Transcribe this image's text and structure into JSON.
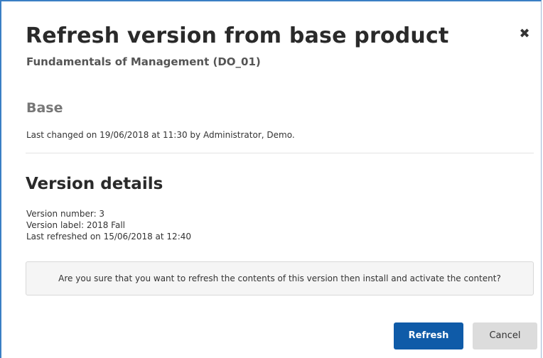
{
  "dialog": {
    "title": "Refresh version from base product",
    "subtitle": "Fundamentals of Management (DO_01)",
    "close_icon": "close-icon",
    "close_glyph": "✖"
  },
  "base": {
    "heading": "Base",
    "last_changed": "Last changed on 19/06/2018 at 11:30 by Administrator, Demo."
  },
  "version_details": {
    "heading": "Version details",
    "version_number": "Version number: 3",
    "version_label": "Version label: 2018 Fall",
    "last_refreshed": "Last refreshed on 15/06/2018 at 12:40"
  },
  "confirmation": {
    "message": "Are you sure that you want to refresh the contents of this version then install and activate the content?"
  },
  "buttons": {
    "refresh_label": "Refresh",
    "cancel_label": "Cancel"
  },
  "colors": {
    "primary_button": "#0f5ba8",
    "dialog_border": "#3b7fc4",
    "secondary_button": "#dcdcdc"
  }
}
